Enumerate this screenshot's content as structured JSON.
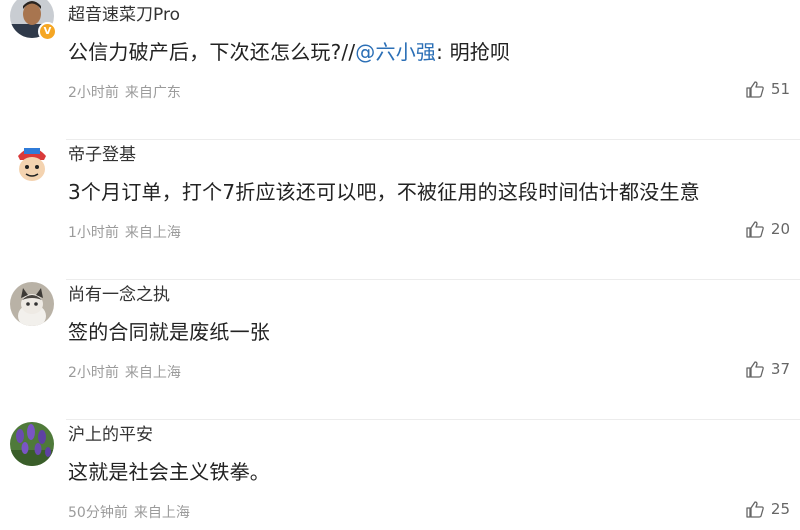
{
  "comments": [
    {
      "username": "超音速菜刀Pro",
      "verified_icon": "v-badge-icon",
      "content_text": "公信力破产后，下次还怎么玩?//",
      "mention": "@六小强",
      "content_suffix": ": 明抢呗",
      "time": "2小时前",
      "location": "来自广东",
      "likes": "51",
      "avatar_icon": "user-photo-avatar"
    },
    {
      "username": "帝子登基",
      "content_text": "3个月订单，打个7折应该还可以吧，不被征用的这段时间估计都没生意",
      "time": "1小时前",
      "location": "来自上海",
      "likes": "20",
      "avatar_icon": "cartoon-avatar"
    },
    {
      "username": "尚有一念之执",
      "content_text": "签的合同就是废纸一张",
      "time": "2小时前",
      "location": "来自上海",
      "likes": "37",
      "avatar_icon": "cat-avatar"
    },
    {
      "username": "沪上的平安",
      "content_text": "这就是社会主义铁拳。",
      "time": "50分钟前",
      "location": "来自上海",
      "likes": "25",
      "avatar_icon": "flowers-avatar"
    }
  ],
  "icons": {
    "like": "thumbs-up-icon"
  },
  "colors": {
    "mention": "#2b6fb6",
    "meta": "#9b9b9b",
    "divider": "#ececec",
    "verified_badge": "#f5a623"
  }
}
